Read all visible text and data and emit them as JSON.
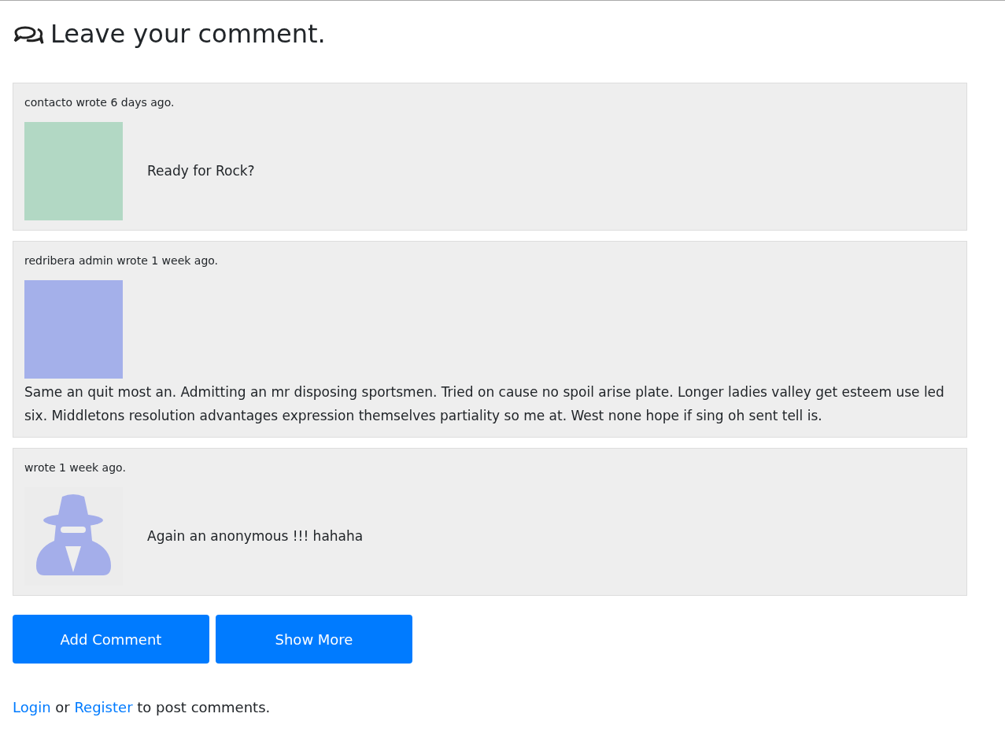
{
  "heading": "Leave your comment.",
  "comments": [
    {
      "byline": "contacto wrote 6 days ago.",
      "avatar": {
        "kind": "photo",
        "color": "#b2d8c4"
      },
      "kind": "inline",
      "text": "Ready for Rock?"
    },
    {
      "byline": "redribera admin wrote 1 week ago.",
      "avatar": {
        "kind": "photo",
        "color": "#a4b0ea"
      },
      "kind": "stacked",
      "text": "Same an quit most an. Admitting an mr disposing sportsmen. Tried on cause no spoil arise plate. Longer ladies valley get esteem use led six. Middletons resolution advantages expression themselves partiality so me at. West none hope if sing oh sent tell is."
    },
    {
      "byline": "wrote 1 week ago.",
      "avatar": {
        "kind": "anonymous",
        "color": "#ececec"
      },
      "kind": "inline",
      "text": "Again an anonymous !!! hahaha"
    }
  ],
  "buttons": [
    "Add Comment",
    "Show More"
  ],
  "footer": {
    "login": "Login",
    "middle": "or",
    "register": "Register",
    "rest": "to post comments."
  }
}
